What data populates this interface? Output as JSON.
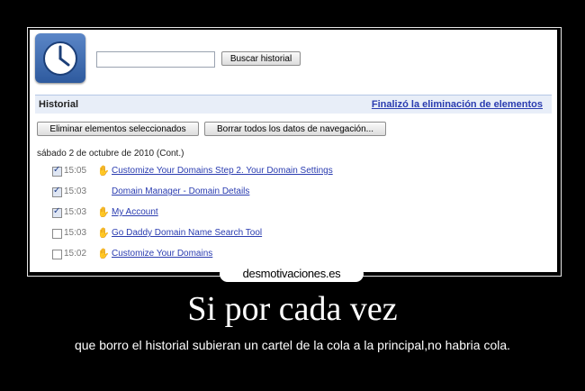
{
  "history": {
    "search_button": "Buscar historial",
    "search_value": "",
    "header_title": "Historial",
    "header_link": "Finalizó la eliminación de elementos",
    "delete_selected": "Eliminar elementos seleccionados",
    "clear_all": "Borrar todos los datos de navegación...",
    "date_label": "sábado 2 de octubre de 2010 (Cont.)",
    "entries": [
      {
        "checked": true,
        "time": "15:05",
        "has_icon": true,
        "title": "Customize Your Domains Step 2. Your Domain Settings"
      },
      {
        "checked": true,
        "time": "15:03",
        "has_icon": false,
        "title": "Domain Manager - Domain Details"
      },
      {
        "checked": true,
        "time": "15:03",
        "has_icon": true,
        "title": "My Account"
      },
      {
        "checked": false,
        "time": "15:03",
        "has_icon": true,
        "title": "Go Daddy Domain Name Search Tool"
      },
      {
        "checked": false,
        "time": "15:02",
        "has_icon": true,
        "title": "Customize Your Domains"
      }
    ],
    "icons": {
      "app": "clock-icon",
      "entry": "favicon-icon"
    },
    "colors": {
      "link": "#2a3cb0",
      "header_bg": "#e8eef8"
    }
  },
  "poster": {
    "watermark": "desmotivaciones.es",
    "title": "Si por cada vez",
    "subtitle": "que borro el historial subieran un cartel de la cola a la principal,no habria cola."
  }
}
